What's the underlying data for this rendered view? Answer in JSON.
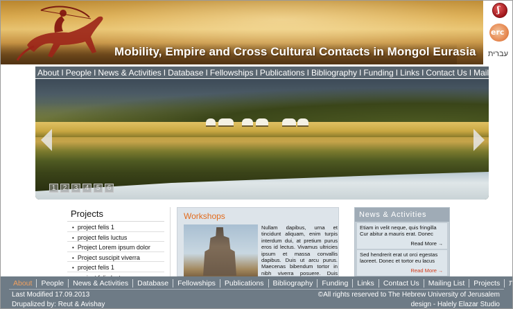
{
  "header": {
    "title": "Mobility, Empire and Cross Cultural Contacts in Mongol Eurasia",
    "hebrew_link": "עברית",
    "logo_huji_text": "ʃ",
    "logo_erc_text": "erc"
  },
  "topnav": {
    "items": [
      "About",
      "People",
      "News & Activities",
      "Database",
      "Fellowships",
      "Publications",
      "Bibliography",
      "Funding",
      "Links",
      "Contact Us",
      "Mailing List"
    ],
    "separator": "I"
  },
  "slider": {
    "pager": [
      "1",
      "2",
      "3",
      "4",
      "5",
      "6"
    ]
  },
  "projects": {
    "title": "Projects",
    "items": [
      "project felis 1",
      "project felis luctus",
      "Project Lorem ipsum dolor",
      "Project suscipit viverra",
      "project felis 1",
      "project felis luctus"
    ]
  },
  "workshops": {
    "title": "Workshops",
    "text": "Nullam dapibus, urna et tincidunt aliquam, enim turpis interdum dui, at pretium purus eros id lectus. Vivamus ultricies ipsum et massa convallis dapibus. Duis ut arcu purus. Maecenas bibendum tortor in nibh viverra posuere. Duis pretium lobortis dolor eu semper neque pharetra."
  },
  "news": {
    "title": "News & Activities",
    "items": [
      {
        "text": "Etiam in velit neque, quis fringilla Cur abitur a mauris erat. Donec ipsum ips",
        "more": "Read More"
      },
      {
        "text": "Sed hendrerit erat ut orci egestas laoreet. Donec et tortor eu lacus egestas iaculis. Etiam nibh velit met",
        "more": "Read More"
      }
    ],
    "more_arrow": "→"
  },
  "footer": {
    "nav": [
      "About",
      "People",
      "News & Activities",
      "Database",
      "Fellowships",
      "Publications",
      "Bibliography",
      "Funding",
      "Links",
      "Contact Us",
      "Mailing List",
      "Projects",
      "עברית"
    ],
    "active": "About",
    "last_modified": "Last Modified 17.09.2013",
    "drupalized": "Drupalized by: Reut & Avishay",
    "copyright": "©All rights reserved to The Hebrew University of Jerusalem",
    "design_credit": "design - Halely Elazar Studio"
  },
  "colors": {
    "nav_bg": "#5a6670",
    "footer_bg": "#6e7b86",
    "accent_orange": "#e26b1c",
    "read_more_red": "#d23a1a"
  }
}
